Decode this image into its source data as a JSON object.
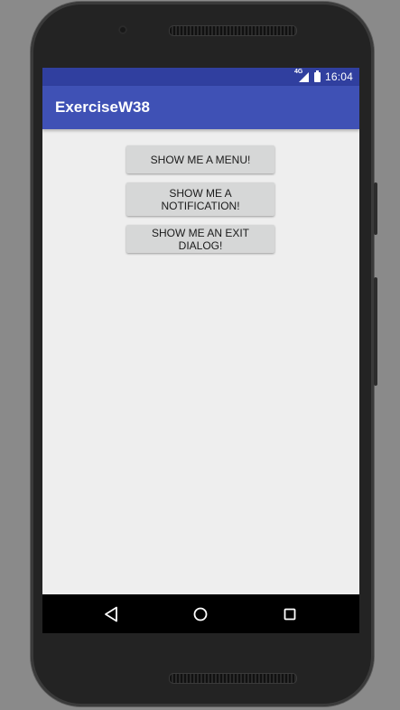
{
  "status_bar": {
    "network": "4G",
    "time": "16:04"
  },
  "app_bar": {
    "title": "ExerciseW38"
  },
  "buttons": [
    {
      "label": "SHOW ME A MENU!"
    },
    {
      "label": "SHOW ME A NOTIFICATION!"
    },
    {
      "label": "SHOW ME AN EXIT DIALOG!"
    }
  ],
  "nav_bar": {
    "icons": [
      "back-icon",
      "home-icon",
      "recents-icon"
    ]
  },
  "colors": {
    "status_bar": "#303f9f",
    "app_bar": "#3f51b5",
    "screen_background": "#eeeeee",
    "button": "#d6d7d7",
    "nav_bar": "#000000"
  }
}
